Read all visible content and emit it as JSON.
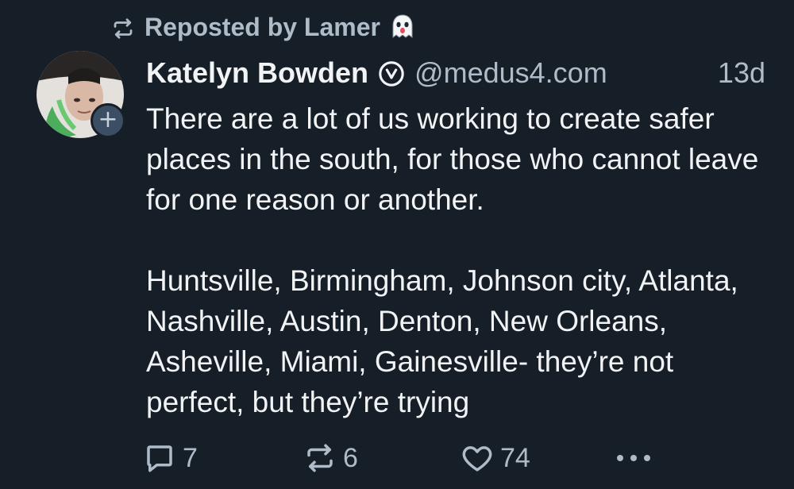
{
  "repost": {
    "label": "Reposted by Lamer",
    "icon": "repost-icon",
    "emoji_icon": "ghost-icon"
  },
  "author": {
    "display_name": "Katelyn Bowden",
    "handle": "@medus4.com",
    "verified_icon": "verified-check-icon",
    "avatar_plus": "+"
  },
  "post": {
    "timestamp": "13d",
    "paragraphs": [
      "There are a lot of us working to create safer places in the south, for those who cannot leave for one reason or another.",
      "Huntsville, Birmingham, Johnson city, Atlanta, Nashville, Austin, Denton, New Orleans, Asheville, Miami, Gainesville- they’re not perfect, but they’re trying"
    ]
  },
  "actions": {
    "reply_count": "7",
    "repost_count": "6",
    "like_count": "74"
  },
  "colors": {
    "background": "#161e27",
    "text_primary": "#f1f3f5",
    "text_secondary": "#aebbc9",
    "plus_badge": "#3b4e63"
  }
}
